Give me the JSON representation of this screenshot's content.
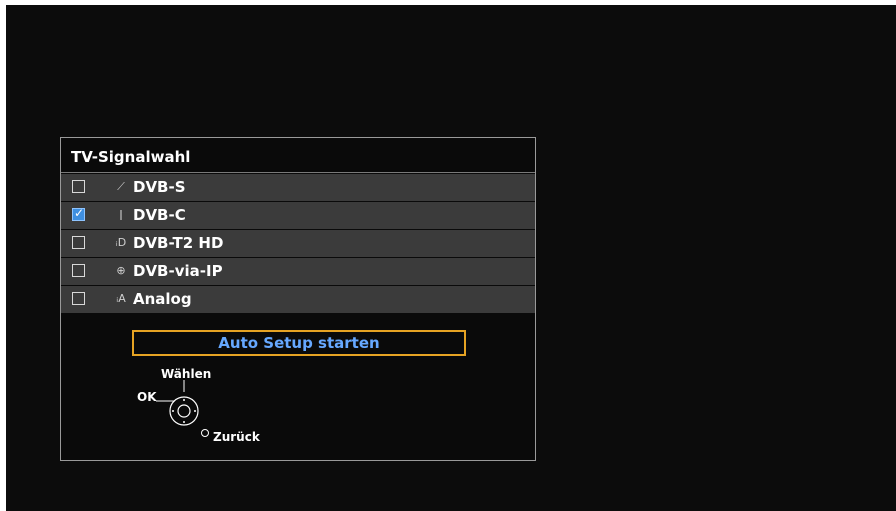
{
  "panel": {
    "title": "TV-Signalwahl",
    "rows": [
      {
        "label": "DVB-S",
        "checked": false,
        "icon": "satellite-icon",
        "glyph": "⟋"
      },
      {
        "label": "DVB-C",
        "checked": true,
        "icon": "cable-icon",
        "glyph": "ǀ"
      },
      {
        "label": "DVB-T2 HD",
        "checked": false,
        "icon": "terrestrial-digital-icon",
        "glyph": "ᵢD"
      },
      {
        "label": "DVB-via-IP",
        "checked": false,
        "icon": "globe-icon",
        "glyph": "⊕"
      },
      {
        "label": "Analog",
        "checked": false,
        "icon": "terrestrial-analog-icon",
        "glyph": "ᵢA"
      }
    ],
    "checkmark": "✓"
  },
  "setup_button": {
    "label": "Auto Setup starten"
  },
  "help": {
    "select": "Wählen",
    "ok": "OK",
    "back": "Zurück"
  },
  "colors": {
    "accent_border": "#e6a323",
    "button_text": "#66a8ff",
    "checkbox_checked": "#3f8fe0",
    "row_background": "#3b3b3b"
  }
}
